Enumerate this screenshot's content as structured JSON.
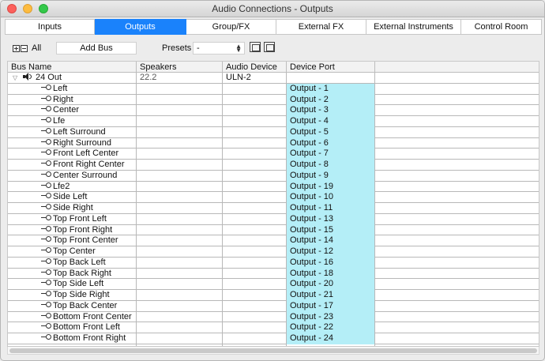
{
  "window": {
    "title": "Audio Connections - Outputs"
  },
  "tabs": [
    {
      "label": "Inputs",
      "active": false
    },
    {
      "label": "Outputs",
      "active": true
    },
    {
      "label": "Group/FX",
      "active": false
    },
    {
      "label": "External FX",
      "active": false
    },
    {
      "label": "External Instruments",
      "active": false
    },
    {
      "label": "Control Room",
      "active": false
    }
  ],
  "toolbar": {
    "all_label": "All",
    "add_bus_label": "Add Bus",
    "presets_label": "Presets",
    "presets_value": "-"
  },
  "table": {
    "columns": [
      "Bus Name",
      "Speakers",
      "Audio Device",
      "Device Port"
    ],
    "bus": {
      "name": "24 Out",
      "speakers": "22.2",
      "device": "ULN-2",
      "port": ""
    },
    "channels": [
      {
        "name": "Left",
        "port": "Output - 1"
      },
      {
        "name": "Right",
        "port": "Output - 2"
      },
      {
        "name": "Center",
        "port": "Output - 3"
      },
      {
        "name": "Lfe",
        "port": "Output - 4"
      },
      {
        "name": "Left Surround",
        "port": "Output - 5"
      },
      {
        "name": "Right Surround",
        "port": "Output - 6"
      },
      {
        "name": "Front Left Center",
        "port": "Output - 7"
      },
      {
        "name": "Front Right Center",
        "port": "Output - 8"
      },
      {
        "name": "Center Surround",
        "port": "Output - 9"
      },
      {
        "name": "Lfe2",
        "port": "Output - 19"
      },
      {
        "name": "Side Left",
        "port": "Output - 10"
      },
      {
        "name": "Side Right",
        "port": "Output - 11"
      },
      {
        "name": "Top Front Left",
        "port": "Output - 13"
      },
      {
        "name": "Top Front Right",
        "port": "Output - 15"
      },
      {
        "name": "Top Front Center",
        "port": "Output - 14"
      },
      {
        "name": "Top Center",
        "port": "Output - 12"
      },
      {
        "name": "Top Back Left",
        "port": "Output - 16"
      },
      {
        "name": "Top Back Right",
        "port": "Output - 18"
      },
      {
        "name": "Top Side Left",
        "port": "Output - 20"
      },
      {
        "name": "Top Side Right",
        "port": "Output - 21"
      },
      {
        "name": "Top Back Center",
        "port": "Output - 17"
      },
      {
        "name": "Bottom Front Center",
        "port": "Output - 23"
      },
      {
        "name": "Bottom Front Left",
        "port": "Output - 22"
      },
      {
        "name": "Bottom Front Right",
        "port": "Output - 24"
      }
    ]
  },
  "colors": {
    "tab_active": "#1a82fb",
    "port_assigned": "#b4eef7"
  }
}
